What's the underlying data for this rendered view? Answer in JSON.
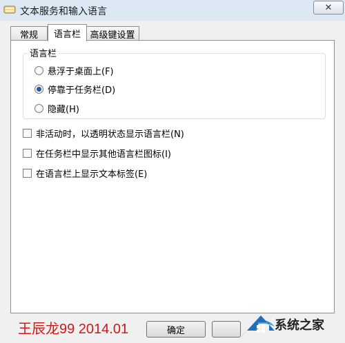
{
  "window": {
    "title": "文本服务和输入语言",
    "close_symbol": "✕"
  },
  "tabs": [
    {
      "label": "常规",
      "active": false
    },
    {
      "label": "语言栏",
      "active": true
    },
    {
      "label": "高级键设置",
      "active": false
    }
  ],
  "language_bar_group": {
    "title": "语言栏",
    "options": [
      {
        "label": "悬浮于桌面上(F)",
        "checked": false
      },
      {
        "label": "停靠于任务栏(D)",
        "checked": true
      },
      {
        "label": "隐藏(H)",
        "checked": false
      }
    ]
  },
  "checkboxes": [
    {
      "label": "非活动时，以透明状态显示语言栏(N)",
      "checked": false
    },
    {
      "label": "在任务栏中显示其他语言栏图标(I)",
      "checked": false
    },
    {
      "label": "在语言栏上显示文本标签(E)",
      "checked": false
    }
  ],
  "buttons": {
    "ok": "确定"
  },
  "signature": "王辰龙99 2014.01",
  "watermark": {
    "text": "系统之家"
  }
}
